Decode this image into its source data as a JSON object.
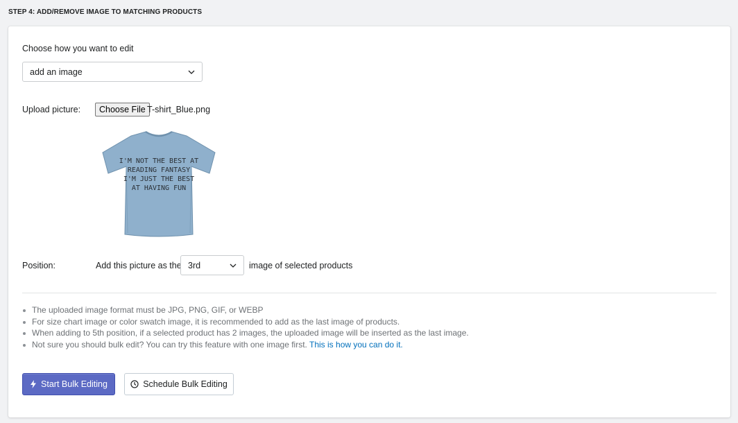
{
  "step": {
    "title": "STEP 4: ADD/REMOVE IMAGE TO MATCHING PRODUCTS"
  },
  "edit_mode": {
    "label": "Choose how you want to edit",
    "selected": "add an image"
  },
  "upload": {
    "label": "Upload picture:",
    "button_label": "Choose File",
    "file_name": "T-shirt_Blue.png",
    "preview": {
      "shirt_color": "#8fb0cc",
      "print_lines": [
        "I'M NOT THE BEST AT",
        "READING FANTASY",
        "I'M JUST THE BEST",
        "AT HAVING FUN"
      ]
    }
  },
  "position": {
    "label": "Position:",
    "prefix": "Add this picture as the",
    "selected": "3rd",
    "suffix": "image of selected products"
  },
  "notes": {
    "items": [
      "The uploaded image format must be JPG, PNG, GIF, or WEBP",
      "For size chart image or color swatch image, it is recommended to add as the last image of products.",
      "When adding to 5th position, if a selected product has 2 images, the uploaded image will be inserted as the last image."
    ],
    "last_text": "Not sure you should bulk edit? You can try this feature with one image first.",
    "last_link": "This is how you can do it."
  },
  "actions": {
    "start_label": "Start Bulk Editing",
    "schedule_label": "Schedule Bulk Editing"
  },
  "colors": {
    "primary": "#5c6ac4",
    "link": "#006fbb",
    "background": "#f1f2f4"
  },
  "icons": {
    "start": "lightning-icon",
    "schedule": "clock-icon",
    "dropdown": "chevron-down-icon"
  }
}
